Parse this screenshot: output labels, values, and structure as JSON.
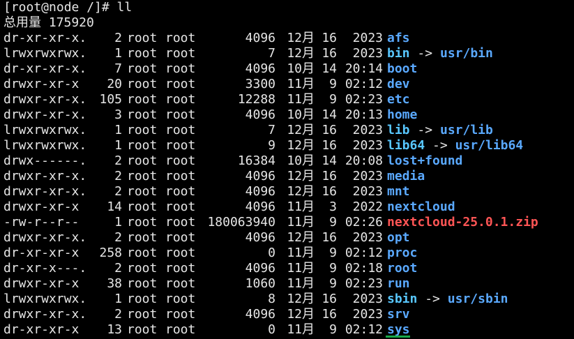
{
  "terminal": {
    "prompt_line": "[root@node /]# ll",
    "total_line": "总用量 175920",
    "colors": {
      "dir": "#5aa9ff",
      "link": "#58c7ff",
      "file": "#ff5555",
      "normal": "#e6e6e6",
      "cursor": "#18a84a"
    }
  },
  "listing": [
    {
      "perm": "dr-xr-xr-x.",
      "links": "2",
      "owner": "root",
      "group": "root",
      "size": "4096",
      "month": "12月",
      "day": "16",
      "timeyear": "2023",
      "name": "afs",
      "type": "dir"
    },
    {
      "perm": "lrwxrwxrwx.",
      "links": "1",
      "owner": "root",
      "group": "root",
      "size": "7",
      "month": "12月",
      "day": "16",
      "timeyear": "2023",
      "name": "bin",
      "type": "link",
      "target": "usr/bin"
    },
    {
      "perm": "dr-xr-xr-x.",
      "links": "7",
      "owner": "root",
      "group": "root",
      "size": "4096",
      "month": "10月",
      "day": "14",
      "timeyear": "20:14",
      "name": "boot",
      "type": "dir"
    },
    {
      "perm": "drwxr-xr-x",
      "links": "20",
      "owner": "root",
      "group": "root",
      "size": "3300",
      "month": "11月",
      "day": "9",
      "timeyear": "02:12",
      "name": "dev",
      "type": "dir"
    },
    {
      "perm": "drwxr-xr-x.",
      "links": "105",
      "owner": "root",
      "group": "root",
      "size": "12288",
      "month": "11月",
      "day": "9",
      "timeyear": "02:23",
      "name": "etc",
      "type": "dir"
    },
    {
      "perm": "drwxr-xr-x.",
      "links": "3",
      "owner": "root",
      "group": "root",
      "size": "4096",
      "month": "10月",
      "day": "14",
      "timeyear": "20:13",
      "name": "home",
      "type": "dir"
    },
    {
      "perm": "lrwxrwxrwx.",
      "links": "1",
      "owner": "root",
      "group": "root",
      "size": "7",
      "month": "12月",
      "day": "16",
      "timeyear": "2023",
      "name": "lib",
      "type": "link",
      "target": "usr/lib"
    },
    {
      "perm": "lrwxrwxrwx.",
      "links": "1",
      "owner": "root",
      "group": "root",
      "size": "9",
      "month": "12月",
      "day": "16",
      "timeyear": "2023",
      "name": "lib64",
      "type": "link",
      "target": "usr/lib64"
    },
    {
      "perm": "drwx------.",
      "links": "2",
      "owner": "root",
      "group": "root",
      "size": "16384",
      "month": "10月",
      "day": "14",
      "timeyear": "20:08",
      "name": "lost+found",
      "type": "dir"
    },
    {
      "perm": "drwxr-xr-x.",
      "links": "2",
      "owner": "root",
      "group": "root",
      "size": "4096",
      "month": "12月",
      "day": "16",
      "timeyear": "2023",
      "name": "media",
      "type": "dir"
    },
    {
      "perm": "drwxr-xr-x.",
      "links": "2",
      "owner": "root",
      "group": "root",
      "size": "4096",
      "month": "12月",
      "day": "16",
      "timeyear": "2023",
      "name": "mnt",
      "type": "dir"
    },
    {
      "perm": "drwxr-xr-x",
      "links": "14",
      "owner": "root",
      "group": "root",
      "size": "4096",
      "month": "11月",
      "day": "3",
      "timeyear": "2022",
      "name": "nextcloud",
      "type": "dir"
    },
    {
      "perm": "-rw-r--r--",
      "links": "1",
      "owner": "root",
      "group": "root",
      "size": "180063940",
      "month": "11月",
      "day": "9",
      "timeyear": "02:26",
      "name": "nextcloud-25.0.1.zip",
      "type": "file"
    },
    {
      "perm": "drwxr-xr-x.",
      "links": "2",
      "owner": "root",
      "group": "root",
      "size": "4096",
      "month": "12月",
      "day": "16",
      "timeyear": "2023",
      "name": "opt",
      "type": "dir"
    },
    {
      "perm": "dr-xr-xr-x",
      "links": "258",
      "owner": "root",
      "group": "root",
      "size": "0",
      "month": "11月",
      "day": "9",
      "timeyear": "02:12",
      "name": "proc",
      "type": "dir"
    },
    {
      "perm": "dr-xr-x---.",
      "links": "2",
      "owner": "root",
      "group": "root",
      "size": "4096",
      "month": "11月",
      "day": "9",
      "timeyear": "02:18",
      "name": "root",
      "type": "dir"
    },
    {
      "perm": "drwxr-xr-x",
      "links": "38",
      "owner": "root",
      "group": "root",
      "size": "1060",
      "month": "11月",
      "day": "9",
      "timeyear": "02:23",
      "name": "run",
      "type": "dir"
    },
    {
      "perm": "lrwxrwxrwx.",
      "links": "1",
      "owner": "root",
      "group": "root",
      "size": "8",
      "month": "12月",
      "day": "16",
      "timeyear": "2023",
      "name": "sbin",
      "type": "link",
      "target": "usr/sbin"
    },
    {
      "perm": "drwxr-xr-x.",
      "links": "2",
      "owner": "root",
      "group": "root",
      "size": "4096",
      "month": "12月",
      "day": "16",
      "timeyear": "2023",
      "name": "srv",
      "type": "dir"
    },
    {
      "perm": "dr-xr-xr-x",
      "links": "13",
      "owner": "root",
      "group": "root",
      "size": "0",
      "month": "11月",
      "day": "9",
      "timeyear": "02:12",
      "name": "sys",
      "type": "dir"
    }
  ],
  "symbols": {
    "link_arrow": "->"
  }
}
